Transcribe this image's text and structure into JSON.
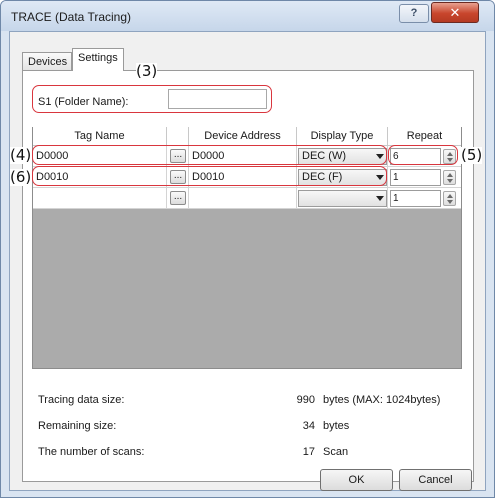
{
  "window": {
    "title": "TRACE (Data Tracing)",
    "help_glyph": "?",
    "close_glyph": "✕"
  },
  "tabs": [
    {
      "label": "Devices",
      "active": false
    },
    {
      "label": "Settings",
      "active": true
    }
  ],
  "folder": {
    "label": "S1 (Folder Name):",
    "value": ""
  },
  "table": {
    "columns": [
      "Tag Name",
      "",
      "Device Address",
      "Display Type",
      "Repeat"
    ],
    "rows": [
      {
        "tag_name": "D0000",
        "browse": "...",
        "device_address": "D0000",
        "display_type": "DEC (W)",
        "repeat": "6"
      },
      {
        "tag_name": "D0010",
        "browse": "...",
        "device_address": "D0010",
        "display_type": "DEC (F)",
        "repeat": "1"
      },
      {
        "tag_name": "",
        "browse": "...",
        "device_address": "",
        "display_type": "",
        "repeat": "1"
      }
    ]
  },
  "callouts": {
    "c3": "(3)",
    "c4": "(4)",
    "c5": "(5)",
    "c6": "(6)",
    "accent_color": "#d9363e"
  },
  "stats": [
    {
      "label": "Tracing data size:",
      "value": "990",
      "unit": "bytes (MAX: 1024bytes)"
    },
    {
      "label": "Remaining size:",
      "value": "34",
      "unit": "bytes"
    },
    {
      "label": "The number of scans:",
      "value": "17",
      "unit": "Scan"
    }
  ],
  "buttons": {
    "ok": "OK",
    "cancel": "Cancel"
  },
  "icons": {
    "help": "help-icon",
    "close": "close-icon",
    "dropdown": "chevron-down-icon",
    "spinner": "spinner-icon"
  }
}
